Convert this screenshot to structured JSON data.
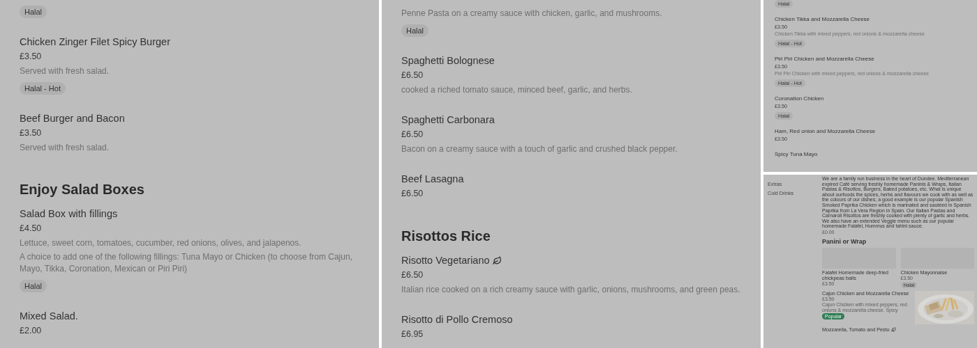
{
  "panels": [
    {
      "kind": "full",
      "blocks": [
        {
          "kind": "item",
          "tags": [
            {
              "label": "Halal",
              "kind": "plain"
            }
          ]
        },
        {
          "kind": "item",
          "name": "Chicken Zinger Filet Spicy Burger",
          "price": "£3.50",
          "description": [
            "Served with fresh salad."
          ],
          "tags": [
            {
              "label": "Halal - Hot",
              "kind": "plain"
            }
          ]
        },
        {
          "kind": "item",
          "name": "Beef Burger and Bacon",
          "price": "£3.50",
          "description": [
            "Served with fresh salad."
          ]
        },
        {
          "kind": "heading",
          "text": "Enjoy Salad Boxes"
        },
        {
          "kind": "item",
          "name": "Salad Box with fillings",
          "price": "£4.50",
          "description": [
            "Lettuce, sweet corn, tomatoes, cucumber, red onions, olives, and jalapenos.",
            "A choice to add one of the following fillings: Tuna Mayo or Chicken (to choose from Cajun, Mayo, Tikka, Coronation, Mexican or Piri Piri)"
          ],
          "tags": [
            {
              "label": "Halal",
              "kind": "plain"
            }
          ]
        },
        {
          "kind": "item",
          "name": "Mixed Salad.",
          "price": "£2.00"
        }
      ]
    },
    {
      "kind": "full",
      "blocks": [
        {
          "kind": "item",
          "description": [
            "Penne Pasta on a creamy sauce with chicken, garlic, and mushrooms."
          ],
          "tags": [
            {
              "label": "Halal",
              "kind": "plain"
            }
          ]
        },
        {
          "kind": "item",
          "name": "Spaghetti Bolognese",
          "price": "£6.50",
          "description": [
            "cooked a riched tomato sauce, minced beef, garlic, and herbs."
          ]
        },
        {
          "kind": "item",
          "name": "Spaghetti Carbonara",
          "price": "£6.50",
          "description": [
            "Bacon on a creamy sauce with a touch of garlic and crushed black pepper."
          ]
        },
        {
          "kind": "item",
          "name": "Beef Lasagna",
          "price": "£6.50"
        },
        {
          "kind": "heading",
          "text": "Risottos Rice"
        },
        {
          "kind": "item",
          "name": "Risotto Vegetariano",
          "price": "£6.50",
          "description": [
            "Italian rice cooked on a rich creamy sauce with garlic, onions, mushrooms, and green peas."
          ],
          "vegetarian": true
        },
        {
          "kind": "item",
          "name": "Risotto di Pollo Cremoso",
          "price": "£6.95"
        }
      ]
    },
    {
      "kind": "compact",
      "blocks": [
        {
          "kind": "item",
          "tags": [
            {
              "label": "Halal",
              "kind": "plain"
            }
          ]
        },
        {
          "kind": "item",
          "name": "Chicken Tikka and Mozzarella Cheese",
          "price": "£3.50",
          "description": [
            "Chicken Tikka with mixed peppers, red onions & mozzarella cheese"
          ],
          "tags": [
            {
              "label": "Halal - Hot",
              "kind": "plain"
            }
          ]
        },
        {
          "kind": "item",
          "name": "Piri Piri Chicken and Mozzarella Cheese",
          "price": "£3.50",
          "description": [
            "Piri Piri Chicken with mixed peppers, red onions & mozzarella cheese"
          ],
          "tags": [
            {
              "label": "Halal - Hot",
              "kind": "plain"
            }
          ]
        },
        {
          "kind": "item",
          "name": "Coronation Chicken",
          "price": "£3.50",
          "tags": [
            {
              "label": "Halal",
              "kind": "plain"
            }
          ]
        },
        {
          "kind": "item",
          "name": "Ham, Red onion and Mozzarella Cheese",
          "price": "£3.50"
        },
        {
          "kind": "item",
          "name": "Spicy Tuna Mayo"
        }
      ]
    },
    {
      "kind": "store",
      "sidebar": [
        "Extras",
        "Cold Drinks"
      ],
      "about": "We are a family run business in the heart of Dundee. Mediterranean expired Café serving freshly homemade Paninis & Wraps, Italian Pastas & Risottos, Burgers, Baked potatoes, etc. What is unique about ourfoods the spices, herbs and flavours we cook with as well as the colours of our dishes; a good example is our popular Spanish Smoked Paprika Chicken which is marinated and sautéed in Spanish Paprika from La Vera Region in Spain. Our Italian Pastas and Carnaroli Risottos are freshly cooked with plenty of garlic and herbs. We also have an extended Veggie menu such as our popular homemade Falafel, Hummus and tahini sauce.",
      "about_price": "£0.00",
      "section": "Panini or Wrap",
      "cards": [
        {
          "kind": "tile",
          "name": "Falafel Homemade deep-fried chickpeas balls",
          "price": "£3.50"
        },
        {
          "kind": "tile",
          "name": "Chicken Mayonnaise",
          "price": "£3.50",
          "tags": [
            {
              "label": "Halal",
              "kind": "plain"
            }
          ]
        },
        {
          "kind": "row",
          "name": "Cajun Chicken and Mozzarella Cheese",
          "price": "£3.50",
          "description": [
            "Cajun Chicken with mixed peppers, red onions & mozzarella cheese. Spicy"
          ],
          "tags": [
            {
              "label": "Popular",
              "kind": "highlight"
            }
          ]
        },
        {
          "kind": "title",
          "name": "Mozzarella, Tomato and Pesto",
          "vegetarian": true
        }
      ]
    }
  ]
}
